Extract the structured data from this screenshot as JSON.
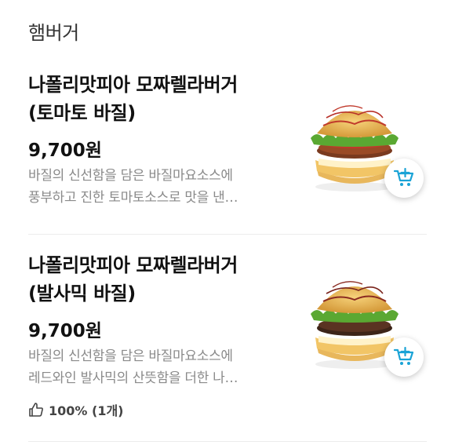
{
  "section": {
    "title": "햄버거"
  },
  "items": [
    {
      "name_line1": "나폴리맛피아 모짜렐라버거",
      "name_line2": "(토마토 바질)",
      "price": "9,700원",
      "desc_line1": "바질의 신선함을 담은 바질마요소스에",
      "desc_line2": "풍부하고 진한 토마토소스로 맛을 낸…",
      "cart_icon": "cart-plus-icon"
    },
    {
      "name_line1": "나폴리맛피아 모짜렐라버거",
      "name_line2": "(발사믹 바질)",
      "price": "9,700원",
      "desc_line1": "바질의 신선함을 담은 바질마요소스에",
      "desc_line2": "레드와인 발사믹의 산뜻함을 더한 나…",
      "rating_icon": "thumbs-up-icon",
      "rating_text": "100% (1개)",
      "cart_icon": "cart-plus-icon"
    }
  ],
  "colors": {
    "accent": "#1aa3d6",
    "muted": "#8a8a8a"
  }
}
